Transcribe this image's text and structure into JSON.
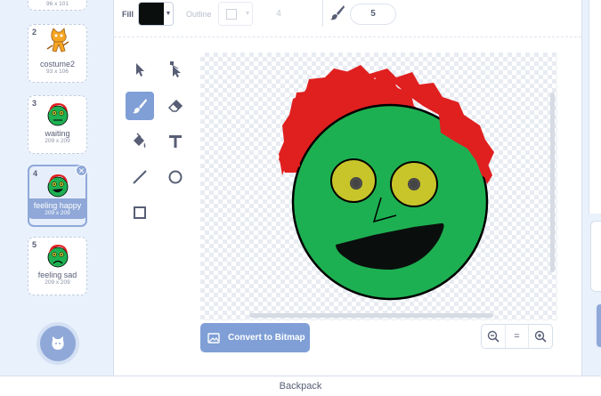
{
  "costumes": [
    {
      "num": "",
      "name": "",
      "size": "96 x 101"
    },
    {
      "num": "2",
      "name": "costume2",
      "size": "93 x 106"
    },
    {
      "num": "3",
      "name": "waiting",
      "size": "209 x 209"
    },
    {
      "num": "4",
      "name": "feeling happy",
      "size": "209 x 209"
    },
    {
      "num": "5",
      "name": "feeling sad",
      "size": "209 x 209"
    }
  ],
  "toolbar": {
    "fill_label": "Fill",
    "fill_color": "#0a0f0d",
    "outline_label": "Outline",
    "outline_width": "4",
    "brush_size": "5"
  },
  "tools": [
    "select-icon",
    "reshape-icon",
    "brush-icon",
    "eraser-icon",
    "fill-icon",
    "text-icon",
    "line-icon",
    "circle-icon",
    "rectangle-icon"
  ],
  "convert_button": "Convert to Bitmap",
  "zoom": {
    "out": "−",
    "reset": "=",
    "in": "+"
  },
  "backpack_label": "Backpack",
  "colors": {
    "accent": "#7f9fd6",
    "face": "#1db052",
    "hair": "#e01f1f",
    "eyes": "#c8c52a"
  }
}
